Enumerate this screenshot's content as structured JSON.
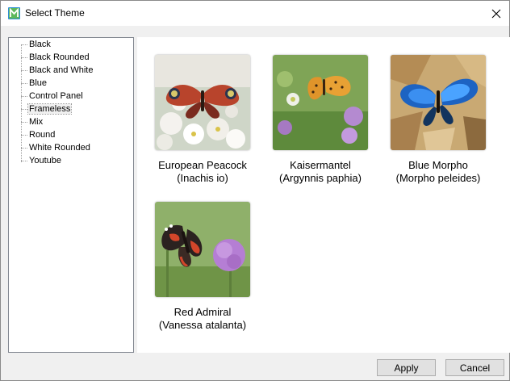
{
  "window": {
    "title": "Select Theme",
    "app_icon": "app-logo-icon",
    "close_icon": "close-icon"
  },
  "tree": {
    "items": [
      {
        "label": "Black",
        "selected": false
      },
      {
        "label": "Black Rounded",
        "selected": false
      },
      {
        "label": "Black and White",
        "selected": false
      },
      {
        "label": "Blue",
        "selected": false
      },
      {
        "label": "Control Panel",
        "selected": false
      },
      {
        "label": "Frameless",
        "selected": true
      },
      {
        "label": "Mix",
        "selected": false
      },
      {
        "label": "Round",
        "selected": false
      },
      {
        "label": "White Rounded",
        "selected": false
      },
      {
        "label": "Youtube",
        "selected": false
      }
    ]
  },
  "gallery": {
    "items": [
      {
        "line1": "European Peacock",
        "line2": "(Inachis io)",
        "image": "european-peacock-butterfly-image"
      },
      {
        "line1": "Kaisermantel",
        "line2": "(Argynnis paphia)",
        "image": "kaisermantel-butterfly-image"
      },
      {
        "line1": "Blue Morpho",
        "line2": "(Morpho peleides)",
        "image": "blue-morpho-butterfly-image"
      },
      {
        "line1": "Red Admiral",
        "line2": "(Vanessa atalanta)",
        "image": "red-admiral-butterfly-image"
      }
    ]
  },
  "buttons": {
    "apply": "Apply",
    "cancel": "Cancel"
  },
  "colors": {
    "background": "#f0f0f0",
    "panel": "#ffffff",
    "border": "#828790",
    "button": "#e1e1e1"
  }
}
